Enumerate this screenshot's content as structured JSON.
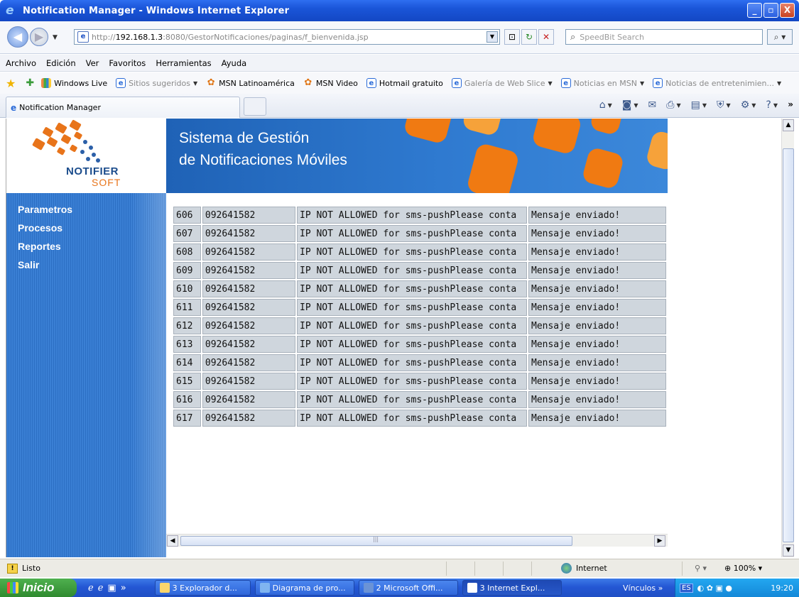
{
  "window": {
    "title": "Notification Manager - Windows Internet Explorer",
    "buttons": [
      "_",
      "▫",
      "X"
    ]
  },
  "address": {
    "url_prefix": "http://",
    "url_host": "192.168.1.3",
    "url_rest": ":8080/GestorNotificaciones/paginas/f_bienvenida.jsp",
    "search_placeholder": "SpeedBit Search"
  },
  "menu": [
    "Archivo",
    "Edición",
    "Ver",
    "Favoritos",
    "Herramientas",
    "Ayuda"
  ],
  "favorites": [
    {
      "label": "Windows Live",
      "icon": "windows-live-icon",
      "dim": false,
      "dropdown": false
    },
    {
      "label": "Sitios sugeridos",
      "icon": "ie-icon",
      "dim": true,
      "dropdown": true
    },
    {
      "label": "MSN Latinoamérica",
      "icon": "msn-icon",
      "dim": false,
      "dropdown": false
    },
    {
      "label": "MSN Video",
      "icon": "msn-icon",
      "dim": false,
      "dropdown": false
    },
    {
      "label": "Hotmail gratuito",
      "icon": "ie-icon",
      "dim": false,
      "dropdown": false
    },
    {
      "label": "Galería de Web Slice",
      "icon": "ie-icon",
      "dim": true,
      "dropdown": true
    },
    {
      "label": "Noticias en MSN",
      "icon": "ie-icon",
      "dim": true,
      "dropdown": true
    },
    {
      "label": "Noticias de entretenimien...",
      "icon": "ie-icon",
      "dim": true,
      "dropdown": true
    }
  ],
  "tab": {
    "label": "Notification Manager"
  },
  "page": {
    "logo_name": "NOTIFIER",
    "logo_sub": "SOFT",
    "banner_line1": "Sistema de Gestión",
    "banner_line2": "de Notificaciones Móviles",
    "nav": [
      "Parametros",
      "Procesos",
      "Reportes",
      "Salir"
    ],
    "rows": [
      {
        "id": "606",
        "phone": "092641582",
        "error": "IP NOT ALLOWED for sms-pushPlease conta",
        "status": "Mensaje enviado!"
      },
      {
        "id": "607",
        "phone": "092641582",
        "error": "IP NOT ALLOWED for sms-pushPlease conta",
        "status": "Mensaje enviado!"
      },
      {
        "id": "608",
        "phone": "092641582",
        "error": "IP NOT ALLOWED for sms-pushPlease conta",
        "status": "Mensaje enviado!"
      },
      {
        "id": "609",
        "phone": "092641582",
        "error": "IP NOT ALLOWED for sms-pushPlease conta",
        "status": "Mensaje enviado!"
      },
      {
        "id": "610",
        "phone": "092641582",
        "error": "IP NOT ALLOWED for sms-pushPlease conta",
        "status": "Mensaje enviado!"
      },
      {
        "id": "611",
        "phone": "092641582",
        "error": "IP NOT ALLOWED for sms-pushPlease conta",
        "status": "Mensaje enviado!"
      },
      {
        "id": "612",
        "phone": "092641582",
        "error": "IP NOT ALLOWED for sms-pushPlease conta",
        "status": "Mensaje enviado!"
      },
      {
        "id": "613",
        "phone": "092641582",
        "error": "IP NOT ALLOWED for sms-pushPlease conta",
        "status": "Mensaje enviado!"
      },
      {
        "id": "614",
        "phone": "092641582",
        "error": "IP NOT ALLOWED for sms-pushPlease conta",
        "status": "Mensaje enviado!"
      },
      {
        "id": "615",
        "phone": "092641582",
        "error": "IP NOT ALLOWED for sms-pushPlease conta",
        "status": "Mensaje enviado!"
      },
      {
        "id": "616",
        "phone": "092641582",
        "error": "IP NOT ALLOWED for sms-pushPlease conta",
        "status": "Mensaje enviado!"
      },
      {
        "id": "617",
        "phone": "092641582",
        "error": "IP NOT ALLOWED for sms-pushPlease conta",
        "status": "Mensaje enviado!"
      }
    ]
  },
  "status": {
    "text": "Listo",
    "zone": "Internet",
    "zoom": "100%"
  },
  "taskbar": {
    "start": "Inicio",
    "tasks": [
      {
        "label": "3 Explorador d...",
        "active": false
      },
      {
        "label": "Diagrama de pro...",
        "active": false
      },
      {
        "label": "2 Microsoft Offi...",
        "active": false
      },
      {
        "label": "3 Internet Expl...",
        "active": true
      }
    ],
    "links": "Vínculos",
    "lang": "ES",
    "time": "19:20"
  },
  "colors": {
    "sidebar": "#3477cc",
    "banner": "#2f7ad0",
    "accent_orange": "#f07a12",
    "cell_bg": "#cfd6dd"
  }
}
